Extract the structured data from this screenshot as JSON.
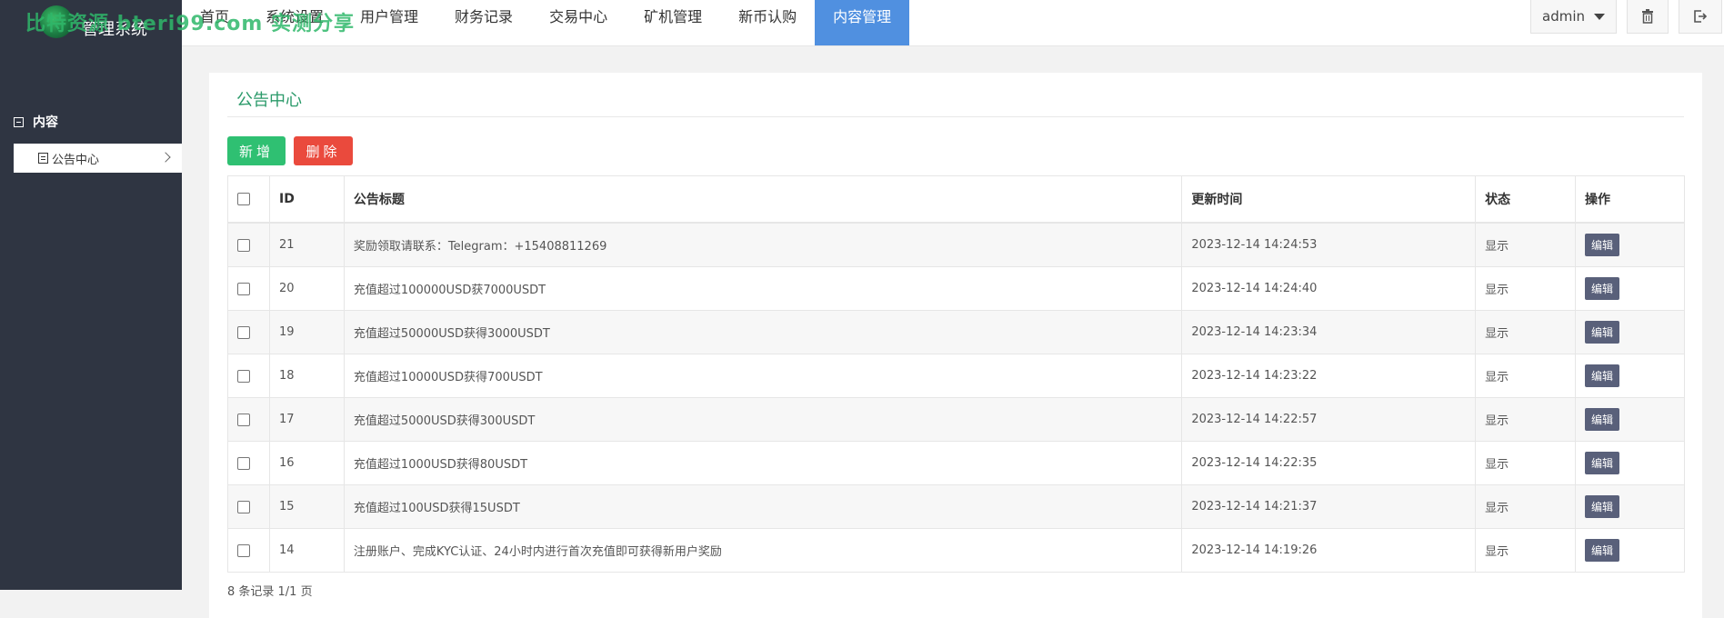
{
  "watermark": "比特资源 bteri99.com 实测分享",
  "brand": {
    "title": "管理系统"
  },
  "nav": {
    "items": [
      {
        "label": "首页"
      },
      {
        "label": "系统设置"
      },
      {
        "label": "用户管理"
      },
      {
        "label": "财务记录"
      },
      {
        "label": "交易中心"
      },
      {
        "label": "矿机管理"
      },
      {
        "label": "新币认购"
      },
      {
        "label": "内容管理"
      }
    ],
    "active_index": 7,
    "admin_label": "admin",
    "trash_icon": "trash-icon",
    "exit_icon": "logout-icon"
  },
  "sidebar": {
    "group_label": "内容",
    "items": [
      {
        "label": "公告中心",
        "icon": "document-icon"
      }
    ]
  },
  "panel": {
    "title": "公告中心",
    "add_label": "新增",
    "delete_label": "删除"
  },
  "table": {
    "headers": {
      "id": "ID",
      "title": "公告标题",
      "updated": "更新时间",
      "status": "状态",
      "action": "操作"
    },
    "rows": [
      {
        "id": "21",
        "title": "奖励领取请联系：Telegram：+15408811269",
        "updated": "2023-12-14 14:24:53",
        "status": "显示",
        "action": "编辑"
      },
      {
        "id": "20",
        "title": "充值超过100000USD获7000USDT",
        "updated": "2023-12-14 14:24:40",
        "status": "显示",
        "action": "编辑"
      },
      {
        "id": "19",
        "title": "充值超过50000USD获得3000USDT",
        "updated": "2023-12-14 14:23:34",
        "status": "显示",
        "action": "编辑"
      },
      {
        "id": "18",
        "title": "充值超过10000USD获得700USDT",
        "updated": "2023-12-14 14:23:22",
        "status": "显示",
        "action": "编辑"
      },
      {
        "id": "17",
        "title": "充值超过5000USD获得300USDT",
        "updated": "2023-12-14 14:22:57",
        "status": "显示",
        "action": "编辑"
      },
      {
        "id": "16",
        "title": "充值超过1000USD获得80USDT",
        "updated": "2023-12-14 14:22:35",
        "status": "显示",
        "action": "编辑"
      },
      {
        "id": "15",
        "title": "充值超过100USD获得15USDT",
        "updated": "2023-12-14 14:21:37",
        "status": "显示",
        "action": "编辑"
      },
      {
        "id": "14",
        "title": "注册账户、完成KYC认证、24小时内进行首次充值即可获得新用户奖励",
        "updated": "2023-12-14 14:19:26",
        "status": "显示",
        "action": "编辑"
      }
    ]
  },
  "footer": {
    "pagination": "8 条记录 1/1 页"
  },
  "colors": {
    "accent": "#5090e0",
    "sidebar": "#2f3542",
    "add": "#2fc072",
    "delete": "#ea4a3d",
    "title": "#2b9a6a"
  }
}
